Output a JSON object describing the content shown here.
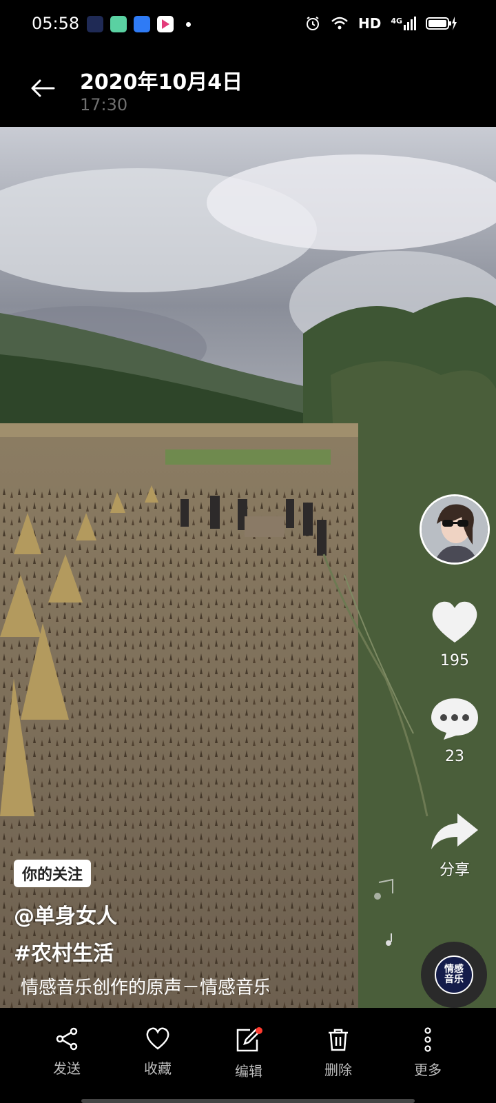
{
  "status_bar": {
    "time": "05:58",
    "network": "HD",
    "signal": "4G",
    "app_icons": [
      "notes-app-icon",
      "wechat-app-icon",
      "cloud-app-icon",
      "video-app-icon"
    ]
  },
  "header": {
    "title": "2020年10月4日",
    "subtitle": "17:30"
  },
  "video": {
    "likes": "195",
    "comments": "23",
    "share_label": "分享",
    "follow_tag": "你的关注",
    "author": "@单身女人",
    "hashtag": "#农村生活",
    "music": "情感音乐创作的原声－情感音乐",
    "disc_text": "情感\n音乐"
  },
  "toolbar": [
    {
      "label": "发送",
      "icon": "share-nodes-icon"
    },
    {
      "label": "收藏",
      "icon": "heart-outline-icon"
    },
    {
      "label": "编辑",
      "icon": "edit-icon"
    },
    {
      "label": "删除",
      "icon": "trash-icon"
    },
    {
      "label": "更多",
      "icon": "more-vertical-icon"
    }
  ],
  "colors": {
    "background": "#000000",
    "accent_dot": "#ff3b30",
    "subtitle_gray": "#6f6f6f"
  }
}
